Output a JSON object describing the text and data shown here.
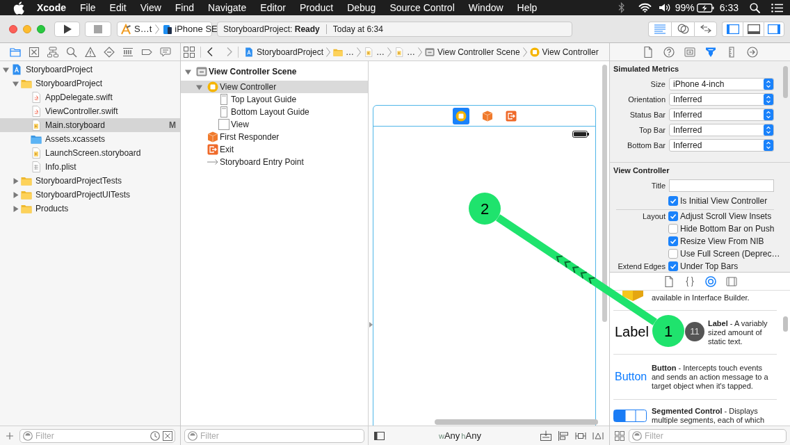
{
  "menu_bar": {
    "app": "Xcode",
    "items": [
      "File",
      "Edit",
      "View",
      "Find",
      "Navigate",
      "Editor",
      "Product",
      "Debug",
      "Source Control",
      "Window",
      "Help"
    ],
    "battery": "99%",
    "clock": "6:33"
  },
  "toolbar": {
    "scheme": "S…t",
    "destination": "iPhone SE",
    "status": "StoryboardProject: **Ready**",
    "time": "Today at 6:34",
    "editor_modes": [
      {
        "selected": true
      },
      {
        "selected": false
      },
      {
        "selected": false
      }
    ],
    "panels": [
      {
        "on": true
      },
      {
        "on": false
      },
      {
        "on": true
      }
    ]
  },
  "navigator": {
    "tabs": [
      {
        "selected": true
      },
      {
        "selected": false
      },
      {
        "selected": false
      },
      {
        "selected": false
      },
      {
        "selected": false
      },
      {
        "selected": false
      },
      {
        "selected": false
      },
      {
        "selected": false
      },
      {
        "selected": false
      }
    ],
    "items": [
      {
        "name": "StoryboardProject",
        "kind": "project",
        "expanded": true,
        "selected": false,
        "children": [
          {
            "name": "StoryboardProject",
            "kind": "folder",
            "expanded": true,
            "selected": false,
            "children": [
              {
                "name": "AppDelegate.swift",
                "kind": "swift",
                "selected": false
              },
              {
                "name": "ViewController.swift",
                "kind": "swift",
                "selected": false
              },
              {
                "name": "Main.storyboard",
                "kind": "storyboard",
                "selected": true,
                "badge": "M"
              },
              {
                "name": "Assets.xcassets",
                "kind": "assets",
                "selected": false
              },
              {
                "name": "LaunchScreen.storyboard",
                "kind": "storyboard",
                "selected": false
              },
              {
                "name": "Info.plist",
                "kind": "plist",
                "selected": false
              }
            ]
          },
          {
            "name": "StoryboardProjectTests",
            "kind": "folder",
            "expanded": false,
            "selected": false
          },
          {
            "name": "StoryboardProjectUITests",
            "kind": "folder",
            "expanded": false,
            "selected": false
          },
          {
            "name": "Products",
            "kind": "folder",
            "expanded": false,
            "selected": false
          }
        ]
      }
    ],
    "filter": {
      "placeholder": "Filter"
    }
  },
  "editor": {
    "jump_bar": [
      {
        "kind": "project",
        "label": "StoryboardProject"
      },
      {
        "kind": "folder",
        "label": "…"
      },
      {
        "kind": "storyboard",
        "label": "…"
      },
      {
        "kind": "storyboard",
        "label": "…"
      },
      {
        "kind": "scene",
        "label": "View Controller Scene"
      },
      {
        "kind": "controller",
        "label": "View Controller"
      }
    ],
    "outline": {
      "items": [
        {
          "name": "View Controller Scene",
          "kind": "scene",
          "expanded": true,
          "selected": false,
          "children": [
            {
              "name": "View Controller",
              "kind": "controller",
              "expanded": true,
              "selected": true,
              "children": [
                {
                  "name": "Top Layout Guide",
                  "kind": "guide",
                  "selected": false
                },
                {
                  "name": "Bottom Layout Guide",
                  "kind": "guide",
                  "selected": false
                },
                {
                  "name": "View",
                  "kind": "view",
                  "selected": false
                }
              ]
            },
            {
              "name": "First Responder",
              "kind": "responder",
              "selected": false
            },
            {
              "name": "Exit",
              "kind": "exit",
              "selected": false
            },
            {
              "name": "Storyboard Entry Point",
              "kind": "entry",
              "selected": false
            }
          ]
        }
      ],
      "filter": {
        "placeholder": "Filter"
      }
    },
    "canvas": {
      "scene_dock": [
        {
          "kind": "controller",
          "selected": true
        },
        {
          "kind": "responder",
          "selected": false
        },
        {
          "kind": "exit",
          "selected": false
        }
      ],
      "size_class": [
        {
          "axis": "w",
          "value": "Any"
        },
        {
          "axis": "h",
          "value": "Any"
        }
      ]
    }
  },
  "inspector": {
    "tabs": [
      {
        "selected": false
      },
      {
        "selected": false
      },
      {
        "selected": false
      },
      {
        "selected": true
      },
      {
        "selected": false
      },
      {
        "selected": false
      }
    ],
    "simulated_metrics": {
      "title": "Simulated Metrics",
      "fields": [
        {
          "label": "Size",
          "value": "iPhone 4-inch"
        },
        {
          "label": "Orientation",
          "value": "Inferred"
        },
        {
          "label": "Status Bar",
          "value": "Inferred"
        },
        {
          "label": "Top Bar",
          "value": "Inferred"
        },
        {
          "label": "Bottom Bar",
          "value": "Inferred"
        }
      ]
    },
    "view_controller": {
      "title": "View Controller",
      "title_field": {
        "label": "Title"
      },
      "initial": {
        "label": "Is Initial View Controller",
        "checked": true
      },
      "options": [
        {
          "group": "Layout",
          "label": "Adjust Scroll View Insets",
          "checked": true
        },
        {
          "label": "Hide Bottom Bar on Push",
          "checked": false
        },
        {
          "label": "Resize View From NIB",
          "checked": true
        },
        {
          "label": "Use Full Screen (Deprec…",
          "checked": false
        },
        {
          "group": "Extend Edges",
          "label": "Under Top Bars",
          "checked": true
        }
      ]
    }
  },
  "library": {
    "tabs": [
      {
        "selected": false
      },
      {
        "selected": false
      },
      {
        "selected": true
      },
      {
        "selected": false
      }
    ],
    "items": [
      {
        "kind": "object",
        "description": "available in Interface Builder."
      },
      {
        "kind": "label",
        "preview": "Label",
        "description": "**Label** - A variably sized amount of static text."
      },
      {
        "kind": "button",
        "preview": "Button",
        "description": "**Button** - Intercepts touch events and sends an action message to a target object when it's tapped."
      },
      {
        "kind": "segmented",
        "description": "**Segmented Control** - Displays multiple segments, each of which"
      }
    ],
    "filter": {
      "placeholder": "Filter"
    }
  },
  "tutorial_overlay": {
    "markers": [
      {
        "number": "2"
      },
      {
        "number": "1"
      }
    ],
    "badge": "11"
  }
}
